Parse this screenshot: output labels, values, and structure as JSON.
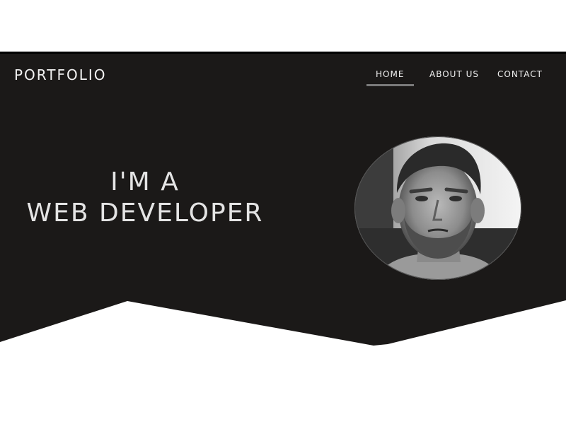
{
  "brand": "PORTFOLIO",
  "nav": {
    "items": [
      {
        "label": "HOME",
        "active": true
      },
      {
        "label": "ABOUT US",
        "active": false
      },
      {
        "label": "CONTACT",
        "active": false
      }
    ]
  },
  "hero": {
    "headline_line1": "I'M A",
    "headline_line2": "WEB DEVELOPER"
  },
  "avatar": {
    "icon": "profile-photo",
    "style": "grayscale portrait"
  },
  "colors": {
    "hero_bg": "#1b1918",
    "page_bg": "#ffffff",
    "nav_underline": "#7a7a7a",
    "text": "#e4e4e4"
  }
}
